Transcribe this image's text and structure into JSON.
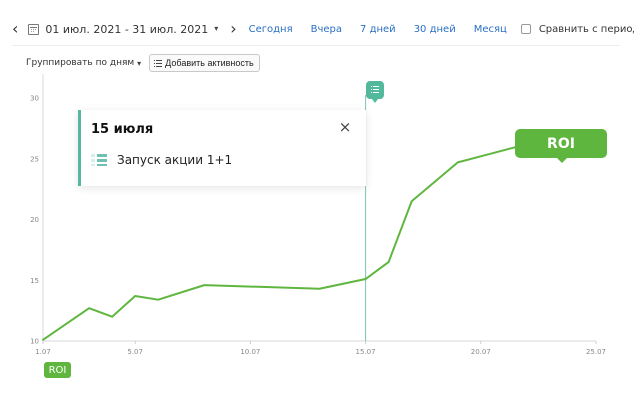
{
  "toolbar": {
    "prev_icon": "‹",
    "date_range": "01 июл. 2021 - 31 июл. 2021",
    "dropdown_icon": "▾",
    "next_icon": "›",
    "periods": [
      {
        "label": "Сегодня"
      },
      {
        "label": "Вчера"
      },
      {
        "label": "7 дней"
      },
      {
        "label": "30 дней"
      },
      {
        "label": "Месяц"
      }
    ],
    "compare_label": "Сравнить с периодом"
  },
  "controls": {
    "group_by": "Группировать по дням",
    "group_chevron": "▾",
    "add_activity": "Добавить активность"
  },
  "tooltip": {
    "date": "15 июля",
    "activity": "Запуск акции 1+1",
    "close_icon": "×"
  },
  "chart_data": {
    "type": "line",
    "series": [
      {
        "name": "ROI",
        "color": "#5fb63f",
        "points": [
          [
            1,
            10.1
          ],
          [
            3,
            12.7
          ],
          [
            4,
            12.0
          ],
          [
            5,
            13.7
          ],
          [
            6,
            13.4
          ],
          [
            8,
            14.6
          ],
          [
            13,
            14.3
          ],
          [
            15,
            15.1
          ],
          [
            16,
            16.5
          ],
          [
            17,
            21.5
          ],
          [
            19,
            24.7
          ],
          [
            20,
            25.2
          ],
          [
            22,
            26.2
          ]
        ]
      }
    ],
    "xlim": [
      1,
      25
    ],
    "ylim": [
      10,
      30
    ],
    "x_ticks": [
      {
        "value": 1,
        "label": "1.07"
      },
      {
        "value": 5,
        "label": "5.07"
      },
      {
        "value": 10,
        "label": "10.07"
      },
      {
        "value": 15,
        "label": "15.07"
      },
      {
        "value": 20,
        "label": "20.07"
      },
      {
        "value": 25,
        "label": "25.07"
      }
    ],
    "y_ticks": [
      {
        "value": 10,
        "label": "10"
      },
      {
        "value": 15,
        "label": "15"
      },
      {
        "value": 20,
        "label": "20"
      },
      {
        "value": 25,
        "label": "25"
      },
      {
        "value": 30,
        "label": "30"
      }
    ],
    "event_marker": {
      "x": 15,
      "color": "#55b8a2"
    },
    "callout_label": "ROI",
    "legend": [
      {
        "label": "ROI",
        "color": "#5fb63f"
      }
    ],
    "grid": false,
    "legend_position": "bottom-left"
  }
}
